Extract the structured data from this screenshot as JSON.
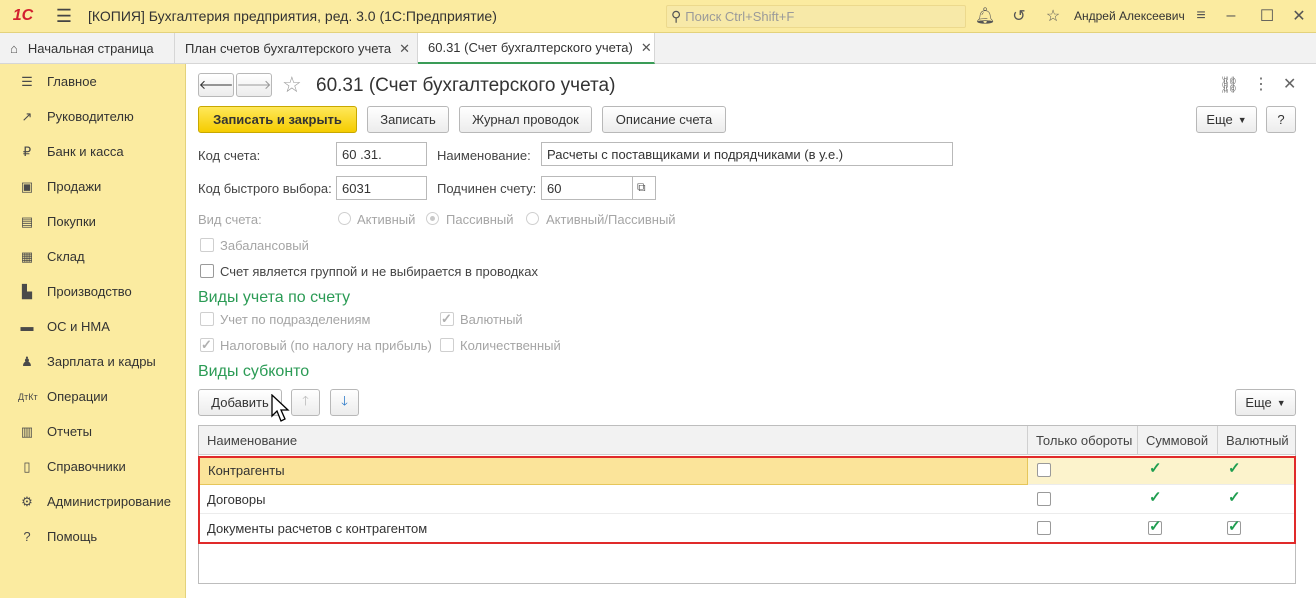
{
  "app": {
    "logo": "1С",
    "title": "[КОПИЯ] Бухгалтерия предприятия, ред. 3.0  (1С:Предприятие)",
    "search_placeholder": "Поиск Ctrl+Shift+F",
    "user": "Андрей Алексеевич"
  },
  "tabs": [
    {
      "label": "Начальная страница"
    },
    {
      "label": "План счетов бухгалтерского учета"
    },
    {
      "label": "60.31 (Счет бухгалтерского учета)"
    }
  ],
  "sidebar": {
    "items": [
      {
        "label": "Главное",
        "icon": "menu-lines-icon"
      },
      {
        "label": "Руководителю",
        "icon": "chart-trend-icon"
      },
      {
        "label": "Банк и касса",
        "icon": "ruble-coin-icon"
      },
      {
        "label": "Продажи",
        "icon": "shopping-bag-icon"
      },
      {
        "label": "Покупки",
        "icon": "shopping-cart-icon"
      },
      {
        "label": "Склад",
        "icon": "warehouse-icon"
      },
      {
        "label": "Производство",
        "icon": "factory-icon"
      },
      {
        "label": "ОС и НМА",
        "icon": "truck-icon"
      },
      {
        "label": "Зарплата и кадры",
        "icon": "person-icon"
      },
      {
        "label": "Операции",
        "icon": "debit-credit-icon"
      },
      {
        "label": "Отчеты",
        "icon": "bar-chart-icon"
      },
      {
        "label": "Справочники",
        "icon": "book-icon"
      },
      {
        "label": "Администрирование",
        "icon": "gear-icon"
      },
      {
        "label": "Помощь",
        "icon": "question-icon"
      }
    ]
  },
  "form": {
    "title": "60.31 (Счет бухгалтерского учета)",
    "buttons": {
      "save_close": "Записать и закрыть",
      "save": "Записать",
      "journal": "Журнал проводок",
      "description": "Описание счета",
      "more": "Еще",
      "help": "?"
    },
    "code_label": "Код счета:",
    "code_value": "60 .31.",
    "name_label": "Наименование:",
    "name_value": "Расчеты с поставщиками и подрядчиками (в у.е.)",
    "quick_label": "Код быстрого выбора:",
    "quick_value": "6031",
    "parent_label": "Подчинен счету:",
    "parent_value": "60",
    "type_label": "Вид счета:",
    "type_options": [
      "Активный",
      "Пассивный",
      "Активный/Пассивный"
    ],
    "offbalance_label": "Забалансовый",
    "group_label": "Счет является группой и не выбирается в проводках",
    "accounting_section": "Виды учета по счету",
    "acc_divisions": "Учет по подразделениям",
    "acc_currency": "Валютный",
    "acc_tax": "Налоговый (по налогу на прибыль)",
    "acc_quantity": "Количественный",
    "subconto_section": "Виды субконто",
    "add_button": "Добавить",
    "more2": "Еще"
  },
  "table": {
    "columns": [
      "Наименование",
      "Только обороты",
      "Суммовой",
      "Валютный"
    ],
    "rows": [
      {
        "name": "Контрагенты",
        "turnover_only": false,
        "sum": true,
        "currency": true
      },
      {
        "name": "Договоры",
        "turnover_only": false,
        "sum": true,
        "currency": true
      },
      {
        "name": "Документы расчетов с контрагентом",
        "turnover_only": false,
        "sum": true,
        "currency": true
      }
    ]
  }
}
